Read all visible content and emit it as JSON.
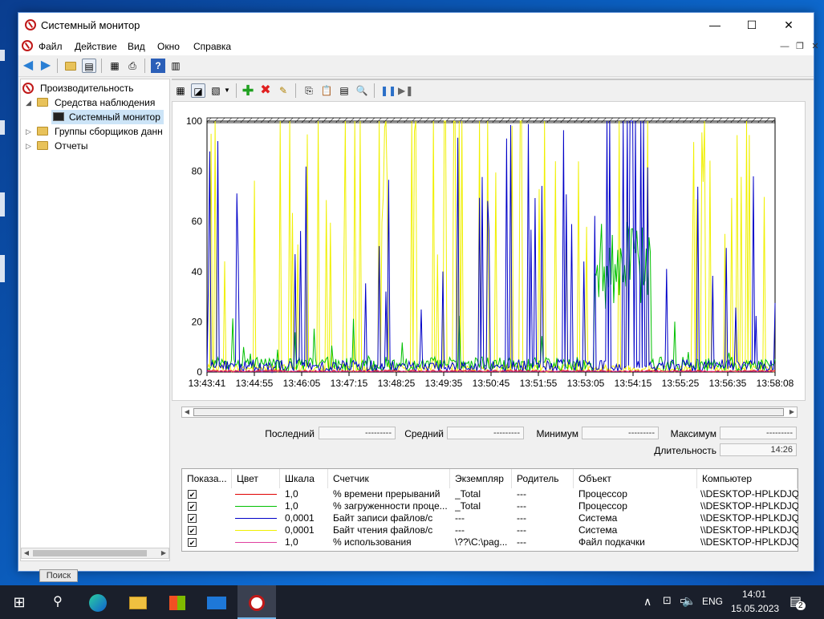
{
  "window": {
    "title": "Системный монитор",
    "controls": {
      "minimize": "—",
      "maximize": "☐",
      "close": "✕"
    }
  },
  "menu": [
    "Файл",
    "Действие",
    "Вид",
    "Окно",
    "Справка"
  ],
  "tree": {
    "root": "Производительность",
    "monitoring_tools": "Средства наблюдения",
    "system_monitor": "Системный монитор",
    "collector_sets": "Группы сборщиков данн",
    "reports": "Отчеты"
  },
  "graph": {
    "y_ticks": [
      "100",
      "80",
      "60",
      "40",
      "20",
      "0"
    ],
    "x_ticks": [
      "13:43:41",
      "13:44:55",
      "13:46:05",
      "13:47:15",
      "13:48:25",
      "13:49:35",
      "13:50:45",
      "13:51:55",
      "13:53:05",
      "13:54:15",
      "13:55:25",
      "13:56:35",
      "13:58:08"
    ],
    "colors": {
      "red": "#e00000",
      "green": "#00c000",
      "blue": "#0000c8",
      "yellow": "#f0f000",
      "pink": "#e040a0"
    }
  },
  "stats": {
    "last_label": "Последний",
    "last_value": "---------",
    "avg_label": "Средний",
    "avg_value": "---------",
    "min_label": "Минимум",
    "min_value": "---------",
    "max_label": "Максимум",
    "max_value": "---------",
    "duration_label": "Длительность",
    "duration_value": "14:26"
  },
  "table": {
    "headers": [
      "Показа...",
      "Цвет",
      "Шкала",
      "Счетчик",
      "Экземпляр",
      "Родитель",
      "Объект",
      "Компьютер"
    ],
    "rows": [
      {
        "check": "✔",
        "color": "#e00000",
        "scale": "1,0",
        "counter": "% времени прерываний",
        "instance": "_Total",
        "parent": "---",
        "object": "Процессор",
        "computer": "\\\\DESKTOP-HPLKDJQ"
      },
      {
        "check": "✔",
        "color": "#00c000",
        "scale": "1,0",
        "counter": "% загруженности проце...",
        "instance": "_Total",
        "parent": "---",
        "object": "Процессор",
        "computer": "\\\\DESKTOP-HPLKDJQ"
      },
      {
        "check": "✔",
        "color": "#0000c8",
        "scale": "0,0001",
        "counter": "Байт записи файлов/с",
        "instance": "---",
        "parent": "---",
        "object": "Система",
        "computer": "\\\\DESKTOP-HPLKDJQ"
      },
      {
        "check": "✔",
        "color": "#f0f000",
        "scale": "0,0001",
        "counter": "Байт чтения файлов/с",
        "instance": "---",
        "parent": "---",
        "object": "Система",
        "computer": "\\\\DESKTOP-HPLKDJQ"
      },
      {
        "check": "✔",
        "color": "#e040a0",
        "scale": "1,0",
        "counter": "% использования",
        "instance": "\\??\\C:\\pag...",
        "parent": "---",
        "object": "Файл подкачки",
        "computer": "\\\\DESKTOP-HPLKDJQ"
      }
    ]
  },
  "taskbar": {
    "search_tip": "Поиск",
    "lang": "ENG",
    "time": "14:01",
    "date": "15.05.2023",
    "notifications": "2"
  }
}
